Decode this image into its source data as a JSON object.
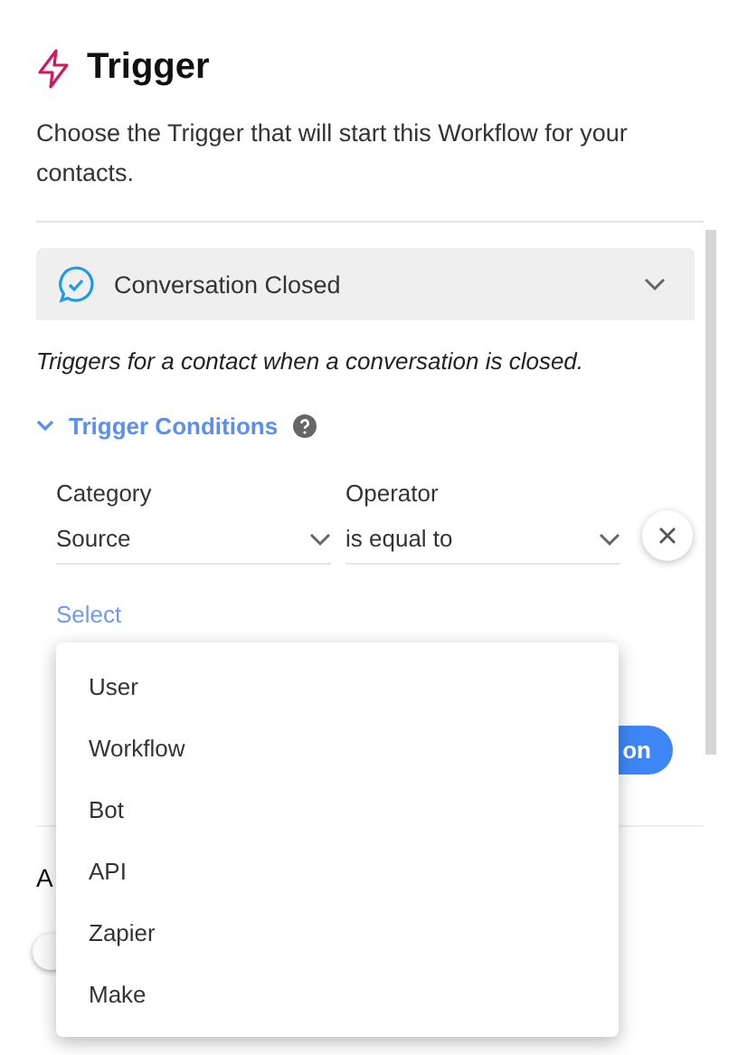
{
  "header": {
    "title": "Trigger",
    "description": "Choose the Trigger that will start this Workflow for your contacts."
  },
  "trigger_select": {
    "value": "Conversation Closed",
    "description": "Triggers for a contact when a conversation is closed."
  },
  "conditions": {
    "title": "Trigger Conditions",
    "expanded": true,
    "fields": [
      {
        "label": "Category",
        "value": "Source"
      },
      {
        "label": "Operator",
        "value": "is equal to"
      }
    ],
    "value_link": "Select",
    "button": "on"
  },
  "dropdown": {
    "items": [
      {
        "label": "User"
      },
      {
        "label": "Workflow"
      },
      {
        "label": "Bot"
      },
      {
        "label": "API"
      },
      {
        "label": "Zapier"
      },
      {
        "label": "Make"
      }
    ]
  },
  "actions": {
    "heading": "A",
    "toggle_on": false
  }
}
